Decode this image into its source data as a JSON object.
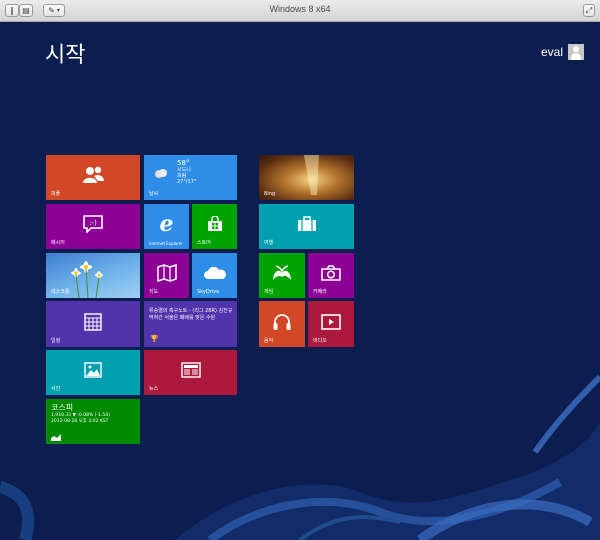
{
  "window": {
    "title": "Windows 8 x64"
  },
  "start": {
    "title": "시작",
    "user": "eval"
  },
  "tiles": {
    "people": "피플",
    "weather": {
      "label": "날씨",
      "temp": "58°",
      "city": "시드니",
      "cond": "흐림",
      "range": "27°/17°"
    },
    "bing": "Bing",
    "messaging": "메시지",
    "ie": "Internet Explorer",
    "store": "스토어",
    "travel": "여행",
    "desktop": "데스크톱",
    "maps": "지도",
    "skydrive": "SkyDrive",
    "games": "게임",
    "camera": "카메라",
    "calendar": "일정",
    "sports": {
      "headline": "류승렬의 축구노트 - (리그 28R) 김진규 막혀간 서울은 패배를 맞은 수원"
    },
    "music": "음악",
    "video": "비디오",
    "photos": "사진",
    "news": "뉴스",
    "finance": {
      "title": "코스피",
      "line1": "1,918.33  ▼ -0.08% (-1.54)",
      "line2": "2012-08-28 오후 3:02 KST"
    }
  },
  "colors": {
    "background": "#0b1e4f",
    "orange": "#d24726",
    "blue": "#2e8de8",
    "purple": "#8c0095",
    "green": "#00a300",
    "teal": "#00a0b1",
    "indigo": "#5133ab",
    "crimson": "#ac193d",
    "finance_green": "#008a00"
  }
}
